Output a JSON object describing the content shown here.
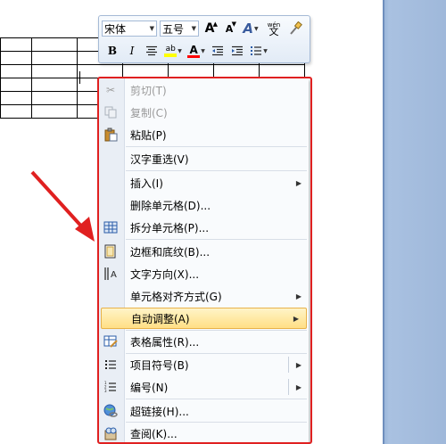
{
  "mini_toolbar": {
    "font_name": "宋体",
    "font_size": "五号",
    "grow_font_label": "A",
    "shrink_font_label": "A",
    "styles_label": "A",
    "phonetic_top": "wén",
    "phonetic_bottom": "文",
    "bold_label": "B",
    "italic_label": "I",
    "font_color_label": "A",
    "highlight_label": "ab"
  },
  "context_menu": {
    "items": [
      {
        "label": "剪切(T)",
        "icon": "scissors-icon",
        "enabled": false
      },
      {
        "label": "复制(C)",
        "icon": "copy-icon",
        "enabled": false
      },
      {
        "label": "粘贴(P)",
        "icon": "paste-icon",
        "enabled": true
      },
      {
        "label": "汉字重选(V)",
        "enabled": true
      },
      {
        "label": "插入(I)",
        "enabled": true,
        "submenu": true
      },
      {
        "label": "删除单元格(D)...",
        "enabled": true
      },
      {
        "label": "拆分单元格(P)...",
        "icon": "split-cells-icon",
        "enabled": true
      },
      {
        "label": "边框和底纹(B)...",
        "icon": "borders-icon",
        "enabled": true
      },
      {
        "label": "文字方向(X)...",
        "icon": "text-direction-icon",
        "enabled": true
      },
      {
        "label": "单元格对齐方式(G)",
        "enabled": true,
        "submenu": true
      },
      {
        "label": "自动调整(A)",
        "enabled": true,
        "submenu": true,
        "highlighted": true
      },
      {
        "label": "表格属性(R)...",
        "icon": "table-properties-icon",
        "enabled": true
      },
      {
        "label": "项目符号(B)",
        "icon": "bullets-icon",
        "enabled": true,
        "submenu": true
      },
      {
        "label": "编号(N)",
        "icon": "numbering-icon",
        "enabled": true,
        "submenu": true
      },
      {
        "label": "超链接(H)...",
        "icon": "hyperlink-icon",
        "enabled": true
      },
      {
        "label": "查阅(K)...",
        "icon": "lookup-icon",
        "enabled": true
      }
    ]
  },
  "colors": {
    "highlight_yellow": "#ffff00",
    "font_red": "#ff0000",
    "annotation_red": "#e02020",
    "app_background": "#a9c1e1"
  }
}
